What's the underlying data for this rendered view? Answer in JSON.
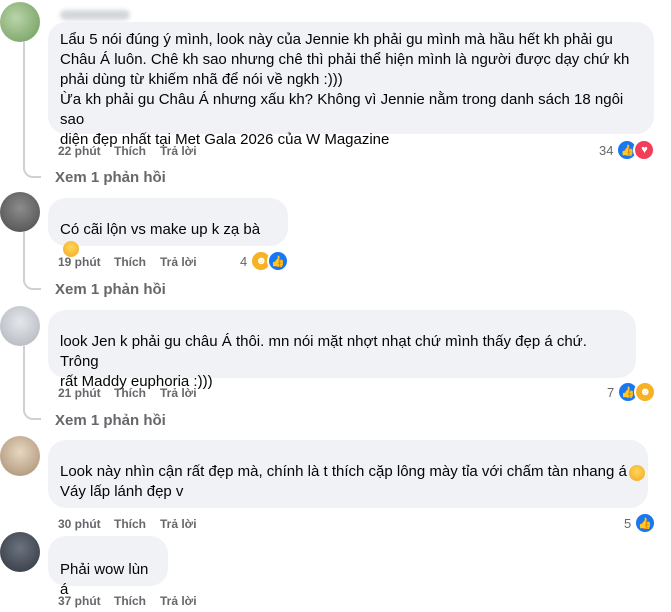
{
  "comments": [
    {
      "text": "Lẩu 5 nói đúng ý mình, look này của Jennie kh phải gu mình mà hầu hết kh phải gu\nChâu Á luôn. Chê kh sao nhưng chê thì phải thể hiện mình là người được dạy chứ kh\nphải dùng từ khiếm nhã để nói về ngkh :)))\nỪa kh phải gu Châu Á nhưng xấu kh? Không vì Jennie nằm trong danh sách 18 ngôi sao\ndiện đẹp nhất tại Met Gala 2026 của W Magazine",
      "time": "22 phút",
      "like_label": "Thích",
      "reply_label": "Trả lời",
      "reaction_count": "34",
      "replies_link": "Xem 1 phản hồi"
    },
    {
      "text": "Có cãi lộn vs make up k zạ bà",
      "time": "19 phút",
      "like_label": "Thích",
      "reply_label": "Trả lời",
      "reaction_count": "4",
      "replies_link": "Xem 1 phản hồi"
    },
    {
      "text": "look Jen k phải gu châu Á thôi. mn nói mặt nhợt nhạt chứ mình thấy đẹp á chứ. Trông\nrất Maddy euphoria :)))",
      "time": "21 phút",
      "like_label": "Thích",
      "reply_label": "Trả lời",
      "reaction_count": "7",
      "replies_link": "Xem 1 phản hồi"
    },
    {
      "text": "Look này nhìn cận rất đẹp mà, chính là t thích cặp lông mày tỉa với chấm tàn nhang á\nVáy lấp lánh đẹp v",
      "time": "30 phút",
      "like_label": "Thích",
      "reply_label": "Trả lời",
      "reaction_count": "5"
    },
    {
      "text": "Phải wow lùn á",
      "time": "37 phút",
      "like_label": "Thích",
      "reply_label": "Trả lời"
    }
  ],
  "icons": {
    "like": "like-reaction-icon",
    "love": "love-reaction-icon",
    "haha": "haha-reaction-icon",
    "eye_roll": "eye-roll-emoji",
    "celebrate": "raised-hands-emoji"
  },
  "colors": {
    "bubble": "#f0f2f5",
    "secondary_text": "#65676b",
    "like": "#1877f2",
    "love": "#f33e58",
    "haha": "#f7b125"
  }
}
